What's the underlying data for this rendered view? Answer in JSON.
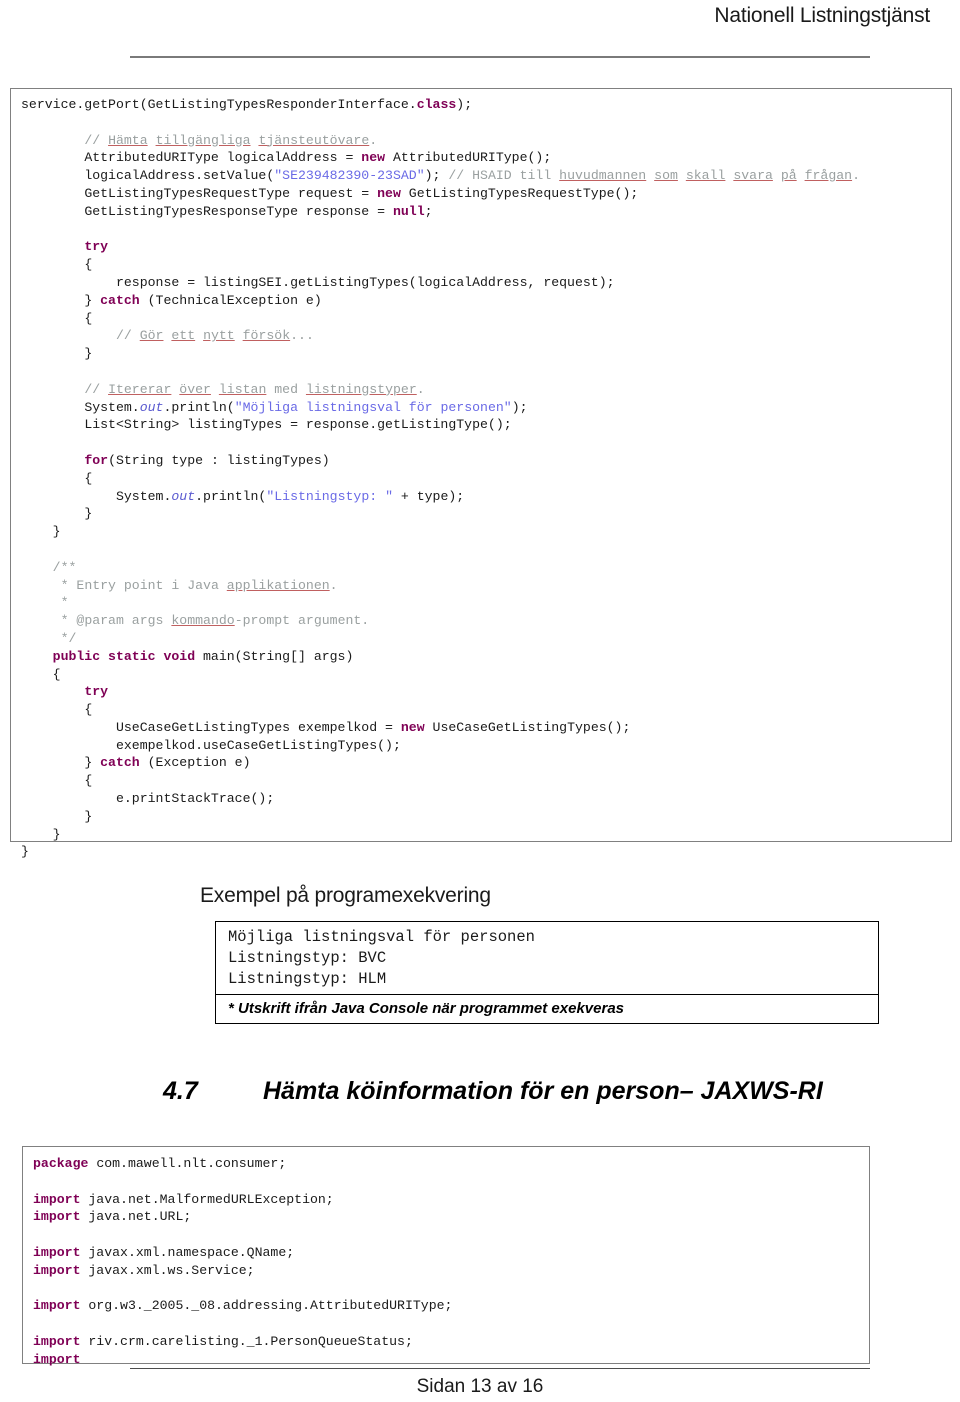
{
  "header": {
    "title": "Nationell Listningstjänst"
  },
  "code_top": {
    "lines": [
      "service.getPort(GetListingTypesResponderInterface.class);",
      "",
      "        // Hämta tillgängliga tjänsteutövare.",
      "        AttributedURIType logicalAddress = new AttributedURIType();",
      "        logicalAddress.setValue(\"SE239482390-23SAD\"); // HSAID till huvudmannen som skall svara på frågan.",
      "        GetListingTypesRequestType request = new GetListingTypesRequestType();",
      "        GetListingTypesResponseType response = null;",
      "",
      "        try",
      "        {",
      "            response = listingSEI.getListingTypes(logicalAddress, request);",
      "        } catch (TechnicalException e)",
      "        {",
      "            // Gör ett nytt försök...",
      "        }",
      "",
      "        // Itererar över listan med listningstyper.",
      "        System.out.println(\"Möjliga listningsval för personen\");",
      "        List<String> listingTypes = response.getListingType();",
      "",
      "        for(String type : listingTypes)",
      "        {",
      "            System.out.println(\"Listningstyp: \" + type);",
      "        }",
      "    }",
      "",
      "    /**",
      "     * Entry point i Java applikationen.",
      "     *",
      "     * @param args kommando-prompt argument.",
      "     */",
      "    public static void main(String[] args)",
      "    {",
      "        try",
      "        {",
      "            UseCaseGetListingTypes exempelkod = new UseCaseGetListingTypes();",
      "            exempelkod.useCaseGetListingTypes();",
      "        } catch (Exception e)",
      "        {",
      "            e.printStackTrace();",
      "        }",
      "    }",
      "}"
    ]
  },
  "example": {
    "title": "Exempel på programexekvering",
    "console_lines": [
      "Möjliga listningsval för personen",
      "Listningstyp: BVC",
      "Listningstyp: HLM"
    ],
    "console_output": "Möjliga listningsval för personen\nListningstyp: BVC\nListningstyp: HLM",
    "note": "* Utskrift ifrån Java Console när programmet exekveras"
  },
  "section": {
    "number": "4.7",
    "title": "Hämta köinformation för en person– JAXWS-RI"
  },
  "code_bottom": {
    "lines": [
      "package com.mawell.nlt.consumer;",
      "",
      "import java.net.MalformedURLException;",
      "import java.net.URL;",
      "",
      "import javax.xml.namespace.QName;",
      "import javax.xml.ws.Service;",
      "",
      "import org.w3._2005._08.addressing.AttributedURIType;",
      "",
      "import riv.crm.carelisting._1.PersonQueueStatus;",
      "import"
    ]
  },
  "footer": {
    "page_text": "Sidan 13 av 16"
  },
  "colors": {
    "keyword": "#7f0055",
    "string": "#6a6ae6",
    "comment": "#9aa0a0",
    "border": "#808080",
    "text": "#1a1a1a"
  }
}
